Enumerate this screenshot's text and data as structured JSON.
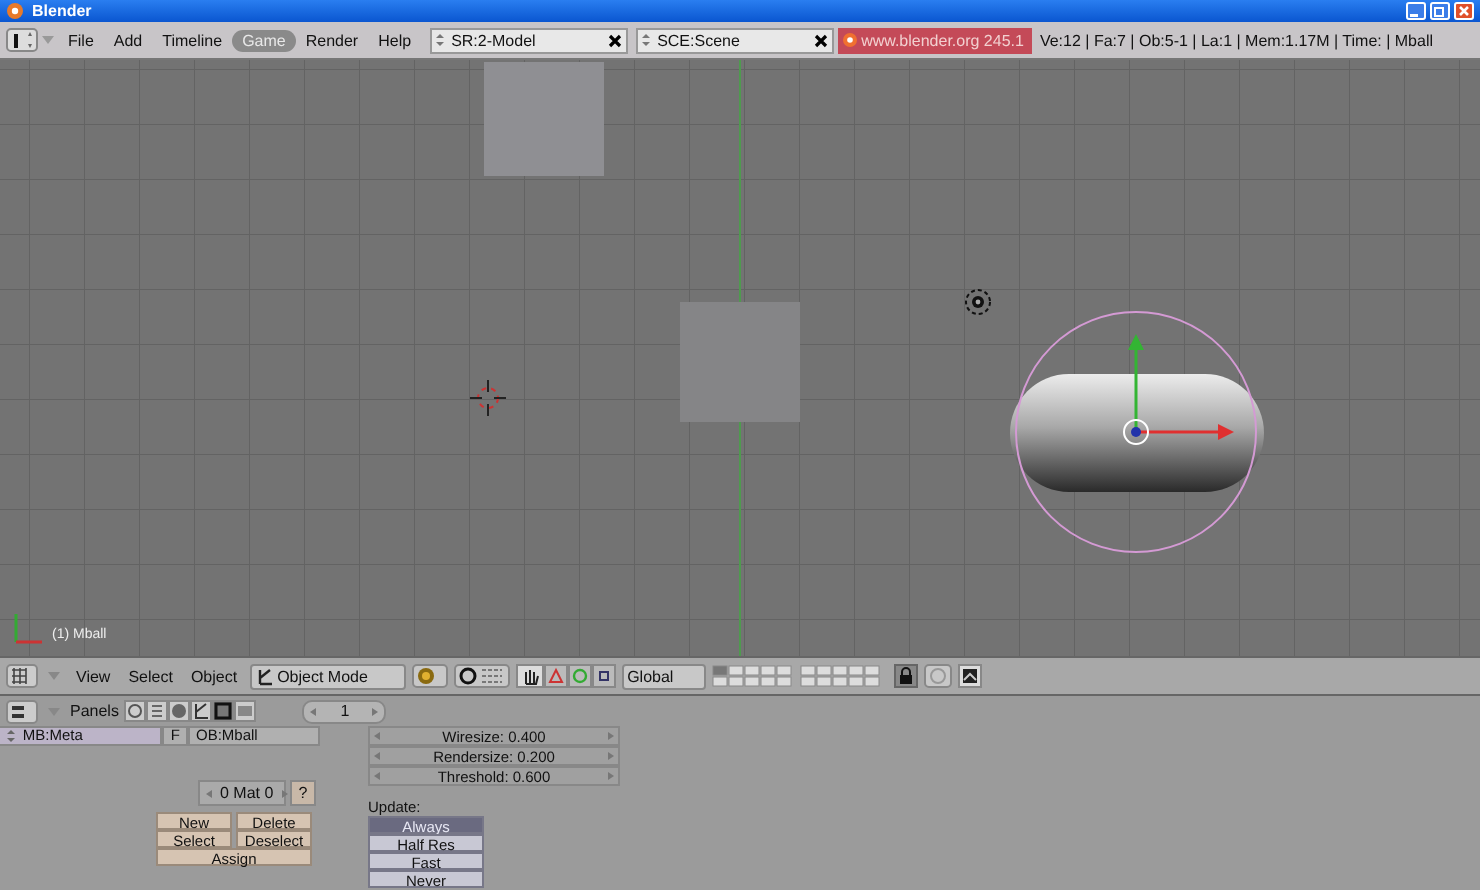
{
  "window": {
    "title": "Blender"
  },
  "menu_bar": {
    "menus": [
      {
        "label": "File",
        "selected": false
      },
      {
        "label": "Add",
        "selected": false
      },
      {
        "label": "Timeline",
        "selected": false
      },
      {
        "label": "Game",
        "selected": true
      },
      {
        "label": "Render",
        "selected": false
      },
      {
        "label": "Help",
        "selected": false
      }
    ],
    "screen_field": "SR:2-Model",
    "scene_field": "SCE:Scene",
    "version": "www.blender.org 245.1",
    "stats": "Ve:12 | Fa:7 | Ob:5-1 | La:1  | Mem:1.17M  | Time: | Mball"
  },
  "viewport": {
    "object_label": "(1) Mball"
  },
  "view_header": {
    "menus": [
      "View",
      "Select",
      "Object"
    ],
    "mode": "Object Mode",
    "orientation": "Global"
  },
  "buttons_header": {
    "label": "Panels",
    "frame": "1"
  },
  "link_panel": {
    "mesh_field": "MB:Meta",
    "fake_user": "F",
    "object_field": "OB:Mball",
    "material_field": "0 Mat 0",
    "help": "?",
    "buttons": [
      "New",
      "Delete",
      "Select",
      "Deselect",
      "Assign"
    ]
  },
  "metaball_panel": {
    "sliders": [
      {
        "label": "Wiresize: 0.400"
      },
      {
        "label": "Rendersize: 0.200"
      },
      {
        "label": "Threshold: 0.600"
      }
    ],
    "update_label": "Update:",
    "update_options": [
      {
        "label": "Always",
        "selected": true
      },
      {
        "label": "Half Res",
        "selected": false
      },
      {
        "label": "Fast",
        "selected": false
      },
      {
        "label": "Never",
        "selected": false
      }
    ]
  }
}
